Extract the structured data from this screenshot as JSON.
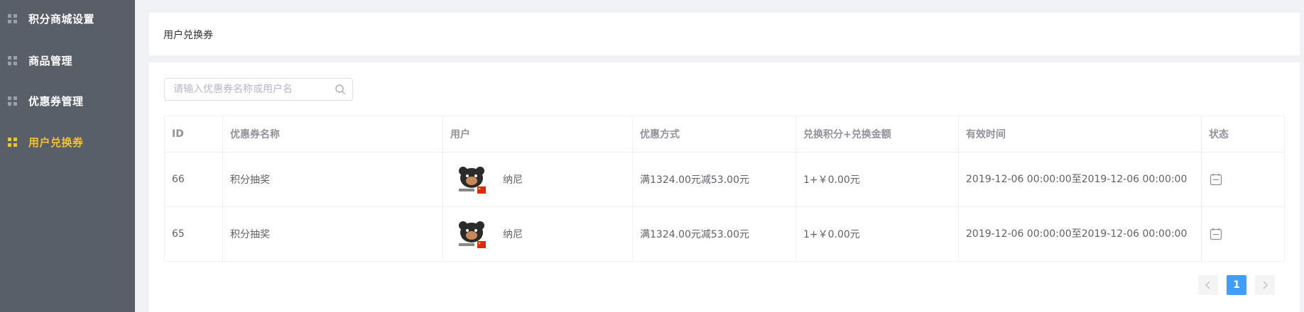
{
  "sidebar": {
    "items": [
      {
        "label": "积分商城设置",
        "active": false
      },
      {
        "label": "商品管理",
        "active": false
      },
      {
        "label": "优惠券管理",
        "active": false
      },
      {
        "label": "用户兑换券",
        "active": true
      }
    ]
  },
  "header": {
    "title": "用户兑换券"
  },
  "search": {
    "placeholder": "请输入优惠券名称或用户名",
    "value": ""
  },
  "table": {
    "columns": [
      "ID",
      "优惠券名称",
      "用户",
      "优惠方式",
      "兑换积分+兑换金额",
      "有效时间",
      "状态"
    ],
    "rows": [
      {
        "id": "66",
        "name": "积分抽奖",
        "user": "纳尼",
        "discount": "满1324.00元减53.00元",
        "points": "1+￥0.00元",
        "valid_time": "2019-12-06 00:00:00至2019-12-06 00:00:00",
        "status_icon": "minus-square-icon"
      },
      {
        "id": "65",
        "name": "积分抽奖",
        "user": "纳尼",
        "discount": "满1324.00元减53.00元",
        "points": "1+￥0.00元",
        "valid_time": "2019-12-06 00:00:00至2019-12-06 00:00:00",
        "status_icon": "minus-square-icon"
      }
    ]
  },
  "pagination": {
    "current_page": "1",
    "prev_icon": "chevron-left-icon",
    "next_icon": "chevron-right-icon"
  },
  "colors": {
    "sidebar_bg": "#595f69",
    "active": "#f2c12e",
    "primary": "#409eff"
  }
}
